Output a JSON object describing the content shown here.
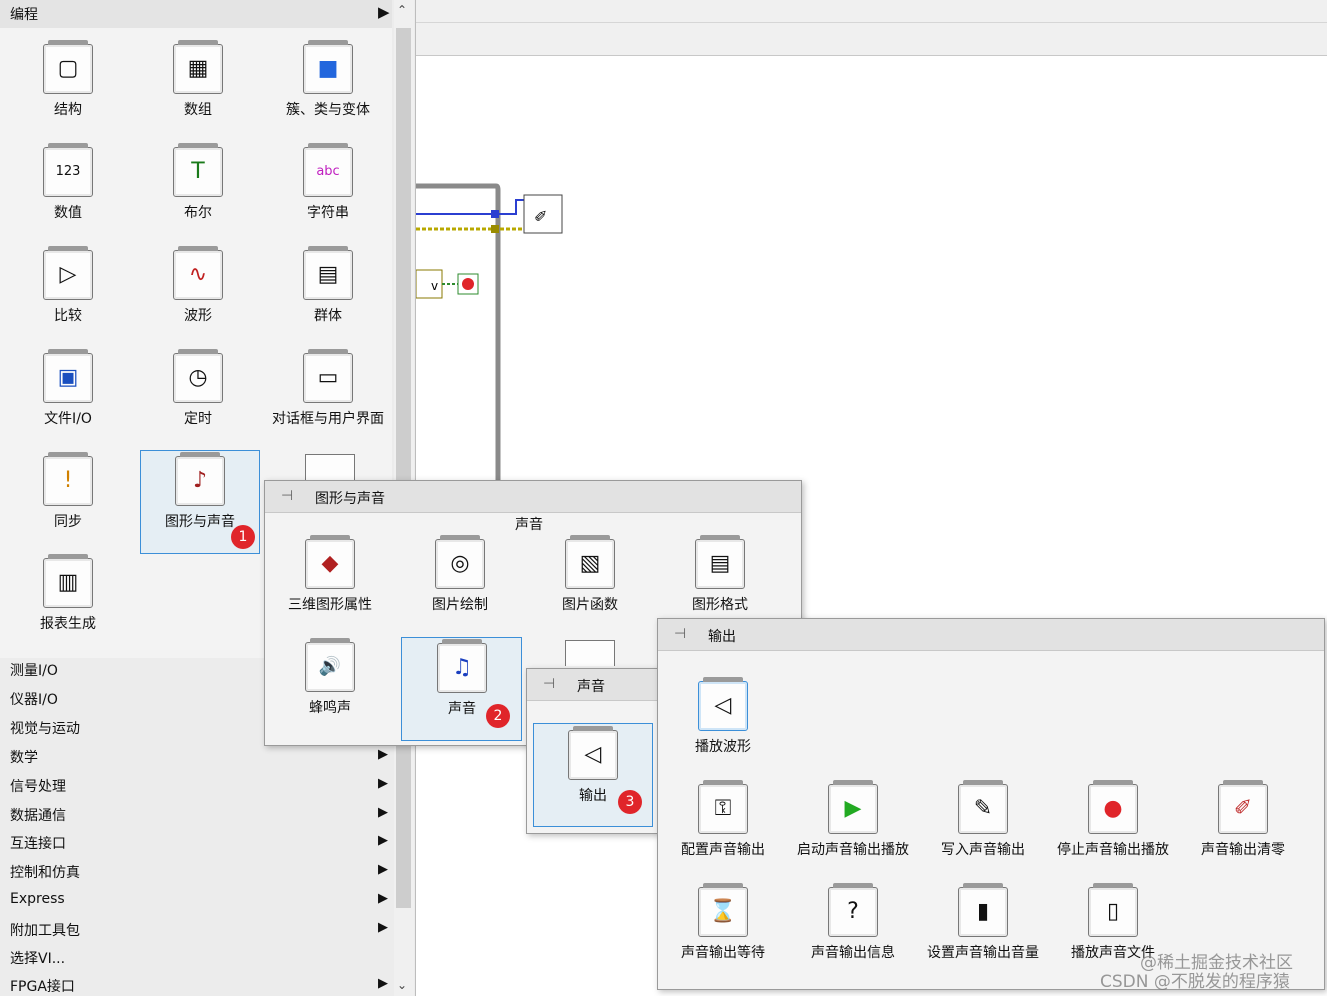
{
  "palette": {
    "title": "编程",
    "grid": [
      {
        "label": "结构",
        "icon": "▢"
      },
      {
        "label": "数组",
        "icon": "▦"
      },
      {
        "label": "簇、类与变体",
        "icon": "■"
      },
      {
        "label": "数值",
        "icon": "123"
      },
      {
        "label": "布尔",
        "icon": "T"
      },
      {
        "label": "字符串",
        "icon": "abc"
      },
      {
        "label": "比较",
        "icon": "▷"
      },
      {
        "label": "波形",
        "icon": "∿"
      },
      {
        "label": "群体",
        "icon": "▤"
      },
      {
        "label": "文件I/O",
        "icon": "▣"
      },
      {
        "label": "定时",
        "icon": "◷"
      },
      {
        "label": "对话框与用户界面",
        "icon": "▭"
      },
      {
        "label": "同步",
        "icon": "!"
      },
      {
        "label": "图形与声音",
        "icon": "♪"
      },
      {
        "label": "报表生成",
        "icon": "▥"
      }
    ],
    "categories": [
      {
        "label": "测量I/O",
        "arrow": ""
      },
      {
        "label": "仪器I/O",
        "arrow": ""
      },
      {
        "label": "视觉与运动",
        "arrow": ""
      },
      {
        "label": "数学",
        "arrow": "▶"
      },
      {
        "label": "信号处理",
        "arrow": "▶"
      },
      {
        "label": "数据通信",
        "arrow": "▶"
      },
      {
        "label": "互连接口",
        "arrow": "▶"
      },
      {
        "label": "控制和仿真",
        "arrow": "▶"
      },
      {
        "label": "Express",
        "arrow": "▶"
      },
      {
        "label": "附加工具包",
        "arrow": "▶"
      },
      {
        "label": "选择VI...",
        "arrow": ""
      },
      {
        "label": "FPGA接口",
        "arrow": "▶"
      }
    ],
    "header_arrow": "▶",
    "scroll_up": "⌃",
    "scroll_down": "⌄"
  },
  "graphics_panel": {
    "title": "图形与声音",
    "pin": "⊣",
    "section": "声音",
    "items": [
      {
        "label": "三维图形属性",
        "icon": "◆"
      },
      {
        "label": "图片绘制",
        "icon": "◎"
      },
      {
        "label": "图片函数",
        "icon": "▧"
      },
      {
        "label": "图形格式",
        "icon": "▤"
      },
      {
        "label": "蜂鸣声",
        "icon": "🔊"
      },
      {
        "label": "声音",
        "icon": "♫"
      }
    ]
  },
  "sound_panel": {
    "title": "声音",
    "pin": "⊣",
    "items": [
      {
        "label": "输出",
        "icon": "◁"
      }
    ]
  },
  "output_panel": {
    "title": "输出",
    "pin": "⊣",
    "items": [
      {
        "label": "播放波形",
        "icon": "◁"
      },
      {
        "label": "配置声音输出",
        "icon": "⚿"
      },
      {
        "label": "启动声音输出播放",
        "icon": "▶"
      },
      {
        "label": "写入声音输出",
        "icon": "✎"
      },
      {
        "label": "停止声音输出播放",
        "icon": "●"
      },
      {
        "label": "声音输出清零",
        "icon": "✐"
      },
      {
        "label": "声音输出等待",
        "icon": "⌛"
      },
      {
        "label": "声音输出信息",
        "icon": "?"
      },
      {
        "label": "设置声音输出音量",
        "icon": "▮"
      },
      {
        "label": "播放声音文件",
        "icon": "▯"
      }
    ]
  },
  "badges": [
    "1",
    "2",
    "3"
  ],
  "watermark": {
    "line1": "@稀土掘金技术社区",
    "line2": "CSDN @不脱发的程序猿"
  },
  "colors": {
    "badge": "#e0252a",
    "selection": "#3c8fd8",
    "wire_blue": "#2b3fd1",
    "wire_yellow": "#b8a800",
    "wire_gray": "#8a8a8a"
  }
}
